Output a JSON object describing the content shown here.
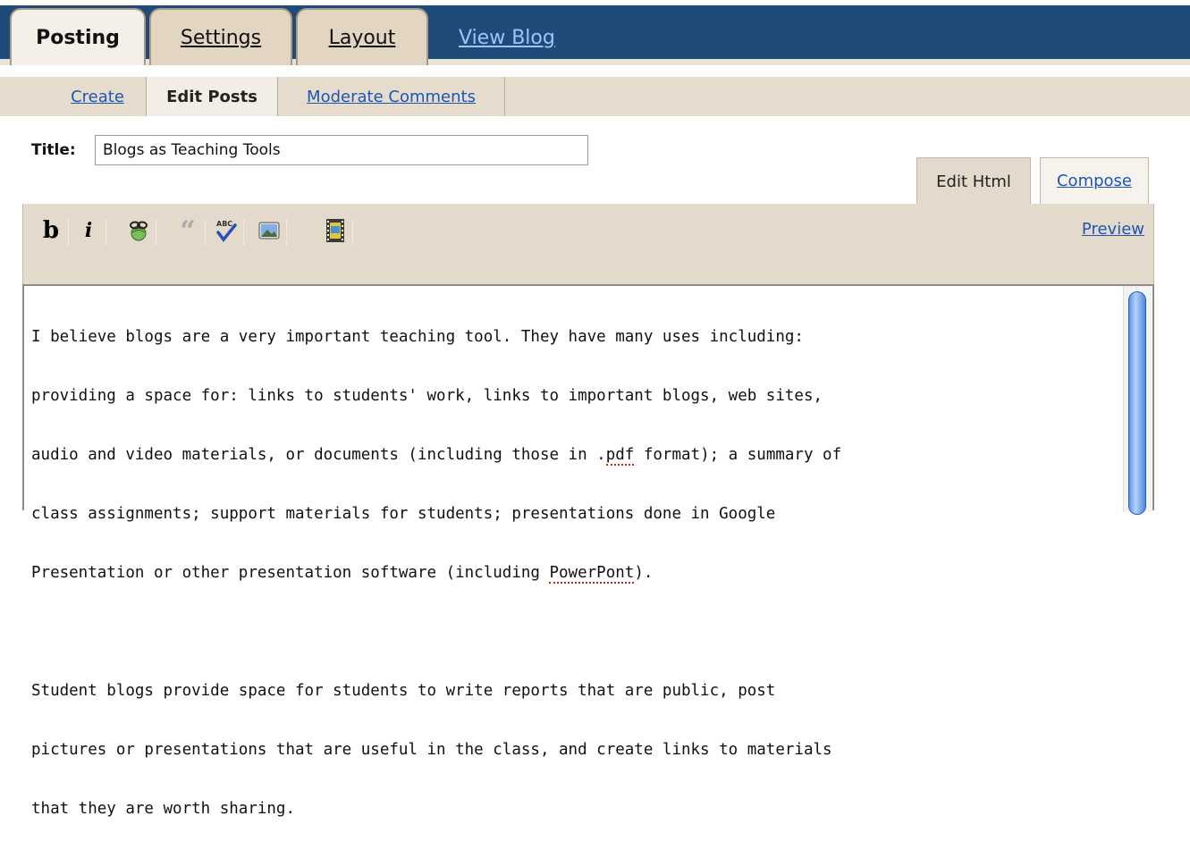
{
  "tabs": {
    "posting": "Posting",
    "settings": "Settings",
    "layout": "Layout",
    "view_blog": "View Blog"
  },
  "subnav": {
    "create": "Create",
    "edit_posts": "Edit Posts",
    "moderate_comments": "Moderate Comments"
  },
  "title": {
    "label": "Title:",
    "value": "Blogs as Teaching Tools"
  },
  "mode_tabs": {
    "edit_html": "Edit Html",
    "compose": "Compose"
  },
  "toolbar": {
    "bold_label": "b",
    "italic_label": "i",
    "quote_label": "“",
    "spellcheck_label": "ABC",
    "preview": "Preview"
  },
  "editor": {
    "lines": [
      "I believe blogs are a very important teaching tool. They have many uses including:",
      "providing a space for: links to students' work, links to important blogs, web sites,",
      "audio and video materials, or documents (including those in .pdf format); a summary of",
      "class assignments; support materials for students; presentations done in Google",
      "Presentation or other presentation software (including PowerPont).",
      "",
      "Student blogs provide space for students to write reports that are public, post",
      "pictures or presentations that are useful in the class, and create links to materials",
      "that they are worth sharing."
    ]
  },
  "colors": {
    "header_blue": "#1f4b78",
    "tan": "#e3dacb",
    "link_blue": "#1f55b3"
  }
}
